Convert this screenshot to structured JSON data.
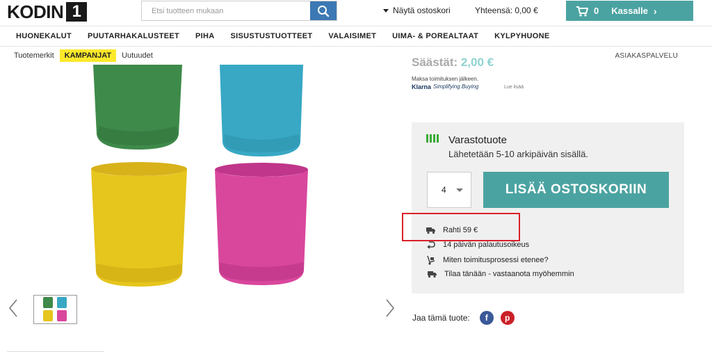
{
  "header": {
    "logo_text": "KODIN",
    "logo_number": "1",
    "search": {
      "placeholder": "Etsi tuotteen mukaan"
    },
    "show_cart_label": "Näytä ostoskori",
    "total_label": "Yhteensä: 0,00 €",
    "cart": {
      "count": "0",
      "checkout_label": "Kassalle",
      "color": "#4ba3a1"
    }
  },
  "main_nav": {
    "items": [
      {
        "label": "HUONEKALUT"
      },
      {
        "label": "PUUTARHAKALUSTEET"
      },
      {
        "label": "PIHA"
      },
      {
        "label": "SISUSTUSTUOTTEET"
      },
      {
        "label": "VALAISIMET"
      },
      {
        "label": "UIMA- & POREALTAAT"
      },
      {
        "label": "KYLPYHUONE"
      }
    ]
  },
  "sub_nav": {
    "brands": "Tuotemerkit",
    "campaigns": "KAMPANJAT",
    "news": "Uutuudet",
    "customer_service": "ASIAKASPALVELU"
  },
  "product": {
    "savings_label": "Säästät:",
    "savings_value": "2,00 €",
    "klarna_note": "Maksa toimituksen jälkeen.",
    "klarna_logo": "Klarna",
    "klarna_tagline": "Simplifying Buying",
    "read_more": "Lue lisää",
    "stock_title": "Varastotuote",
    "stock_subtitle": "Lähetetään 5-10 arkipäivän sisällä.",
    "quantity": "4",
    "add_to_cart": "LISÄÄ OSTOSKORIIN",
    "info": {
      "shipping": "Rahti 59 €",
      "returns": "14 päivän palautusoikeus",
      "delivery_process": "Miten toimitusprosessi etenee?",
      "order_now": "Tilaa tänään - vastaanota myöhemmin"
    },
    "share_label": "Jaa tämä tuote:",
    "accent_color": "#4ba3a1",
    "stock_color": "#3aaa35",
    "highlight_color": "#d9202a"
  }
}
